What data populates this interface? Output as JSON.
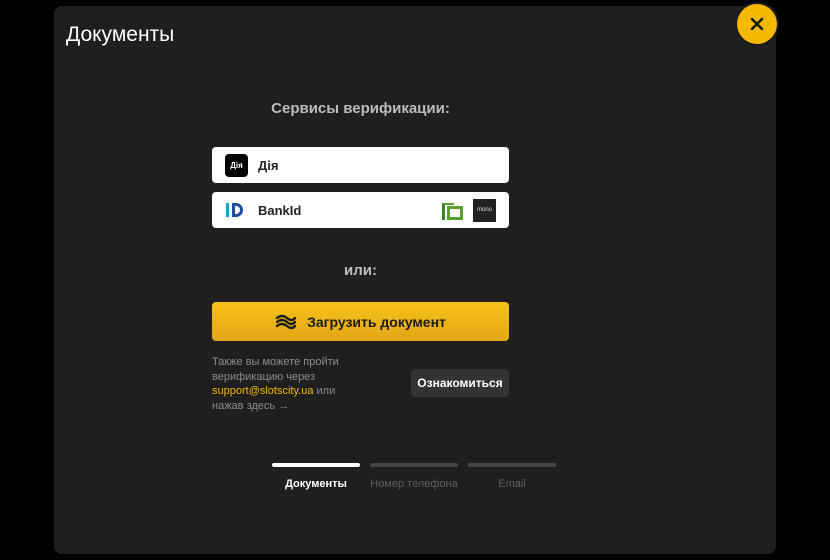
{
  "modal": {
    "title": "Документы"
  },
  "verification": {
    "title": "Сервисы верификации:",
    "services": [
      {
        "label": "Дія",
        "logo_text": "Дія"
      },
      {
        "label": "BankId",
        "partner_logos": [
          {
            "name": "privatbank-logo"
          },
          {
            "name": "monobank-logo",
            "text": "mono"
          }
        ]
      }
    ]
  },
  "or_label": "или:",
  "upload": {
    "label": "Загрузить документ"
  },
  "info": {
    "line1": "Также вы можете пройти",
    "line2": "верификацию через",
    "email": "support@slotscity.ua",
    "or_word": "или",
    "line4": "нажав здесь →"
  },
  "learn_button": {
    "label": "Ознакомиться"
  },
  "steps": [
    {
      "label": "Документы",
      "active": true
    },
    {
      "label": "Номер телефона",
      "active": false
    },
    {
      "label": "Email",
      "active": false
    }
  ],
  "colors": {
    "accent": "#f5b800",
    "background": "#1f1f1f"
  }
}
